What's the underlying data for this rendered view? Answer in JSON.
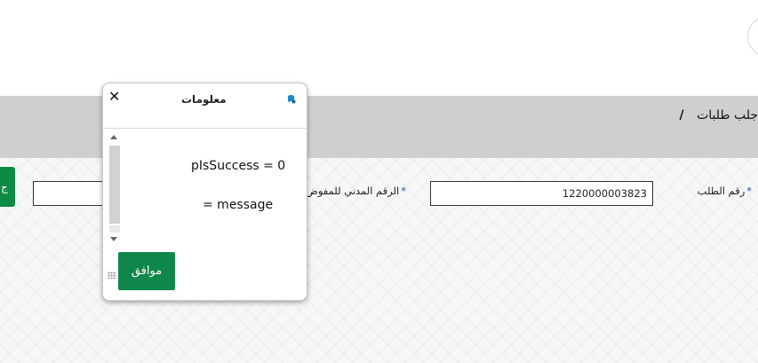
{
  "header": {
    "breadcrumb_text": "جلب طلبات",
    "breadcrumb_separator": "/"
  },
  "form": {
    "request_number_label": "رقم الطلب",
    "request_number_value": "1220000003823",
    "civil_id_label": "الرقم المدني للمفوض",
    "civil_id_value": "",
    "required_marker": "*",
    "side_button_label": "ج"
  },
  "dialog": {
    "title": "معلومات",
    "close_symbol": "✕",
    "line1": "pIsSuccess = 0",
    "line2": "= message",
    "ok_label": "موافق"
  },
  "colors": {
    "header_bar": "#cfcfcf",
    "green_button": "#10874a",
    "required_star": "#1a5aa0"
  },
  "icons": {
    "dialog_info_icon": "info-bubble-icon",
    "close_icon": "close-icon",
    "scroll_up": "scroll-up-arrow-icon",
    "scroll_down": "scroll-down-arrow-icon"
  }
}
